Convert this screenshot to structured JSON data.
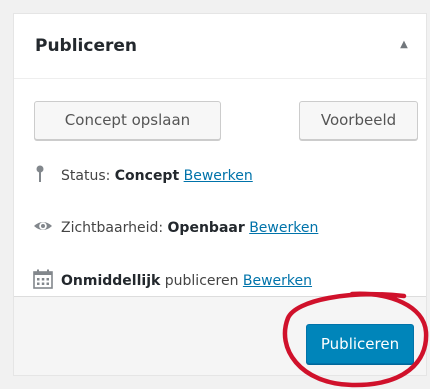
{
  "header": {
    "title": "Publiceren"
  },
  "actions": {
    "save_draft": "Concept opslaan",
    "preview": "Voorbeeld"
  },
  "status": {
    "label": "Status:",
    "value": "Concept",
    "edit": "Bewerken"
  },
  "visibility": {
    "label": "Zichtbaarheid:",
    "value": "Openbaar",
    "edit": "Bewerken"
  },
  "schedule": {
    "value": "Onmiddellijk",
    "label": "publiceren",
    "edit": "Bewerken"
  },
  "footer": {
    "publish": "Publiceren"
  },
  "icons": {
    "toggle": "caret-up-icon",
    "status": "pin-icon",
    "visibility": "eye-icon",
    "schedule": "calendar-icon"
  },
  "colors": {
    "accent": "#0085ba",
    "link": "#0073aa",
    "annotation": "#d0112b"
  }
}
